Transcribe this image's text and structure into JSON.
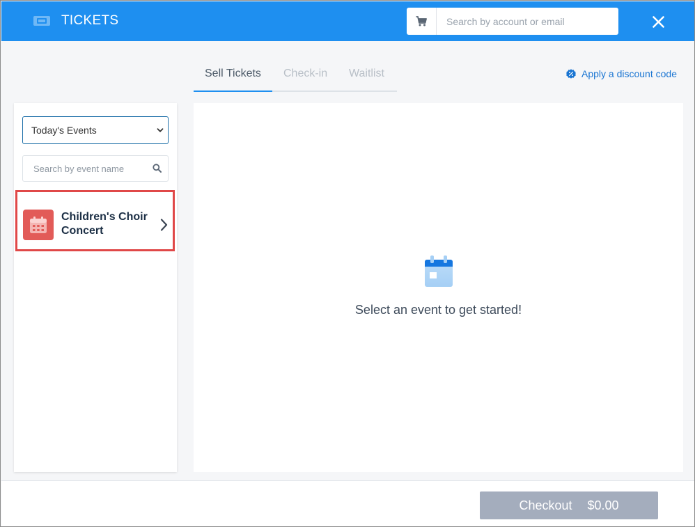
{
  "header": {
    "title": "TICKETS",
    "ticket_icon": "ticket-icon",
    "cart_icon": "cart-icon",
    "search": {
      "placeholder": "Search by account or email",
      "value": ""
    },
    "close_icon": "close-icon"
  },
  "tabs": {
    "items": [
      {
        "label": "Sell Tickets",
        "active": true
      },
      {
        "label": "Check-in",
        "active": false
      },
      {
        "label": "Waitlist",
        "active": false
      }
    ]
  },
  "discount": {
    "label": "Apply a discount code",
    "icon": "discount-icon"
  },
  "sidebar": {
    "event_filter": {
      "selected": "Today's Events"
    },
    "event_search": {
      "placeholder": "Search by event name",
      "value": ""
    },
    "events": [
      {
        "name": "Children's Choir Concert",
        "icon": "calendar-icon",
        "highlighted": true
      }
    ]
  },
  "main": {
    "empty_state": {
      "icon": "calendar-icon",
      "text": "Select an event to get started!"
    }
  },
  "footer": {
    "checkout_label": "Checkout",
    "checkout_total": "$0.00"
  },
  "colors": {
    "header_bg": "#1e8ff0",
    "event_tile": "#e25b58",
    "highlight_border": "#e04848",
    "checkout_bg": "#a4adbd",
    "link": "#1a75d2"
  }
}
